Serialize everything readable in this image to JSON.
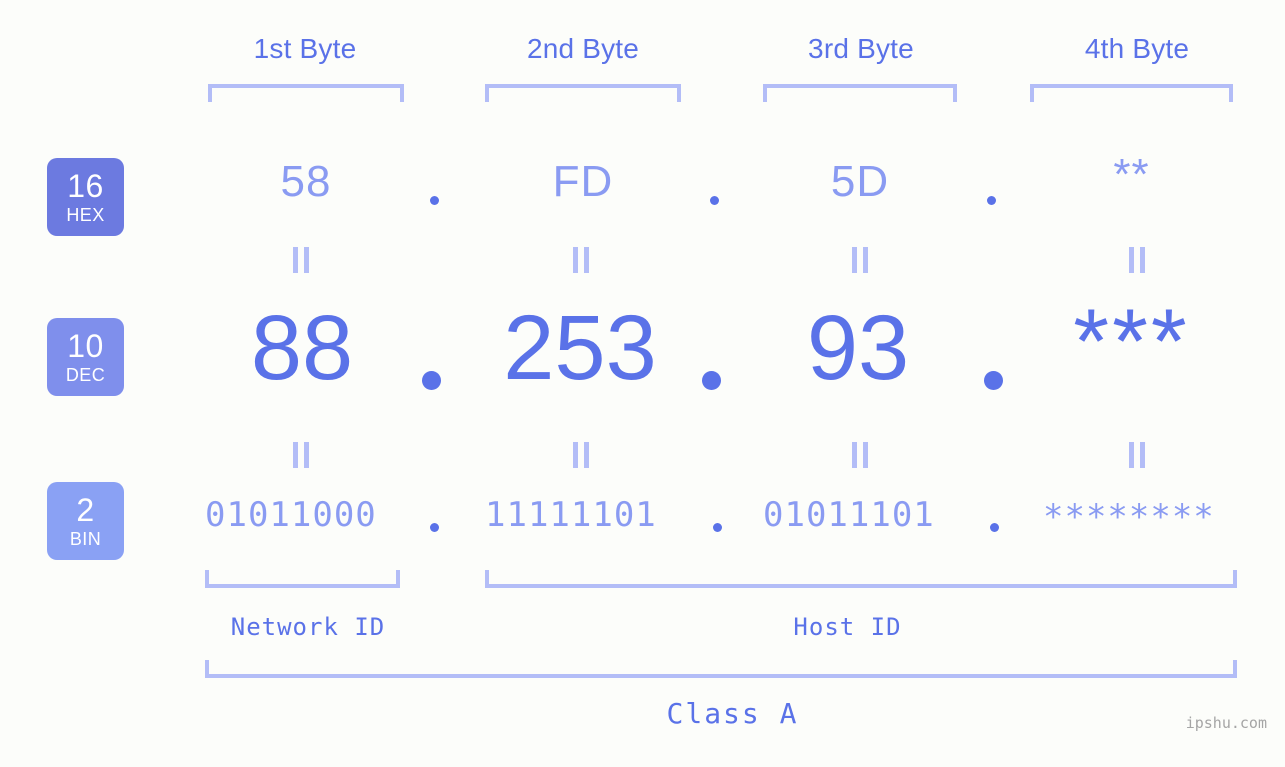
{
  "colors": {
    "background": "#fcfdfa",
    "accent_strong": "#5a72e8",
    "accent_mid": "#8a9bf2",
    "accent_light": "#b3bdf7",
    "badge_hex": "#6c7ae0",
    "badge_dec": "#7f8fec",
    "badge_bin": "#8aa1f4",
    "watermark": "#a5a5a5"
  },
  "header": {
    "byte_labels": [
      "1st Byte",
      "2nd Byte",
      "3rd Byte",
      "4th Byte"
    ]
  },
  "badges": [
    {
      "num": "16",
      "sub": "HEX"
    },
    {
      "num": "10",
      "sub": "DEC"
    },
    {
      "num": "2",
      "sub": "BIN"
    }
  ],
  "rows": {
    "hex": {
      "base_label": "HEX",
      "base_number": "16",
      "values": [
        "58",
        "FD",
        "5D",
        "**"
      ],
      "separator": "."
    },
    "dec": {
      "base_label": "DEC",
      "base_number": "10",
      "values": [
        "88",
        "253",
        "93",
        "***"
      ],
      "separator": "."
    },
    "bin": {
      "base_label": "BIN",
      "base_number": "2",
      "values": [
        "01011000",
        "11111101",
        "01011101",
        "********"
      ],
      "separator": "."
    }
  },
  "equals_marker": "=",
  "footer": {
    "network_id_label": "Network ID",
    "host_id_label": "Host ID",
    "class_label": "Class A"
  },
  "watermark": "ipshu.com",
  "chart_data": {
    "type": "table",
    "title": "IP Address Byte Breakdown",
    "categories": [
      "1st Byte",
      "2nd Byte",
      "3rd Byte",
      "4th Byte"
    ],
    "series": [
      {
        "name": "HEX",
        "values": [
          "58",
          "FD",
          "5D",
          "**"
        ]
      },
      {
        "name": "DEC",
        "values": [
          "88",
          "253",
          "93",
          "***"
        ]
      },
      {
        "name": "BIN",
        "values": [
          "01011000",
          "11111101",
          "01011101",
          "********"
        ]
      }
    ],
    "annotations": [
      "Network ID",
      "Host ID",
      "Class A"
    ]
  }
}
